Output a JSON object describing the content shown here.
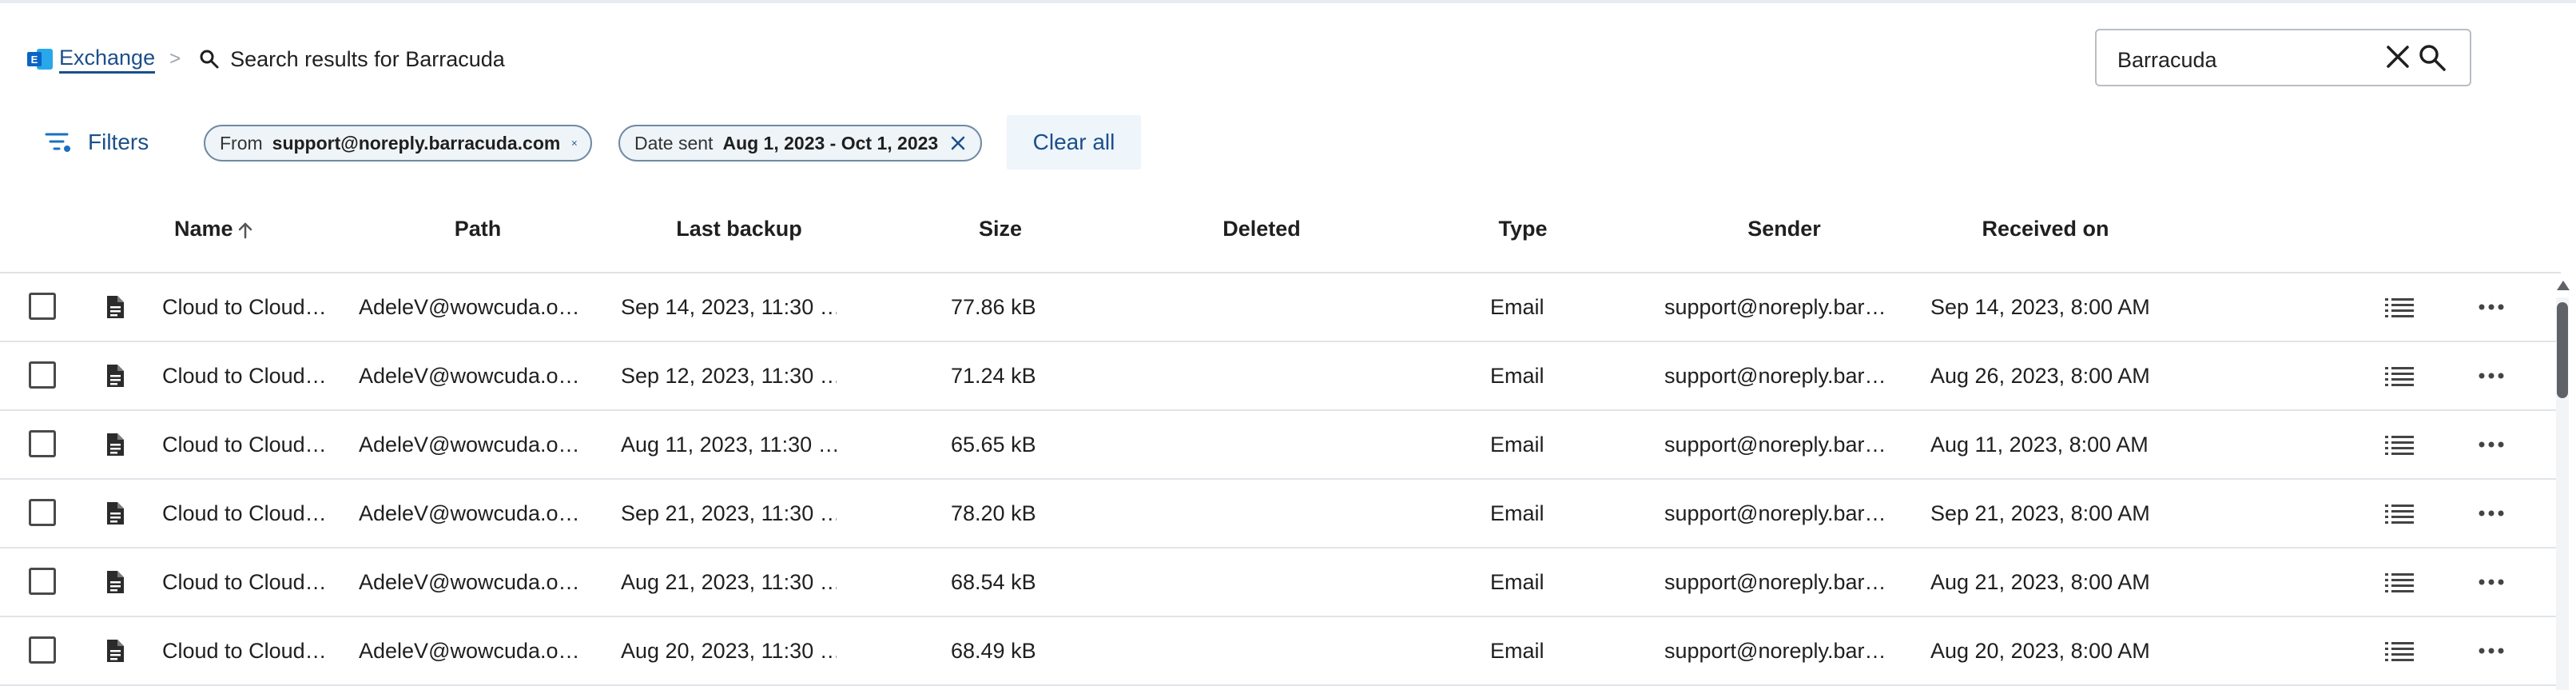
{
  "breadcrumb": {
    "app_label": "Exchange",
    "separator": ">",
    "current": "Search results for Barracuda"
  },
  "search": {
    "value": "Barracuda"
  },
  "filters": {
    "label": "Filters",
    "chips": [
      {
        "key": "From",
        "value": "support@noreply.barracuda.com"
      },
      {
        "key": "Date sent",
        "value": "Aug 1, 2023 - Oct 1, 2023"
      }
    ],
    "clear_all_label": "Clear all"
  },
  "table": {
    "columns": [
      "Name",
      "Path",
      "Last backup",
      "Size",
      "Deleted",
      "Type",
      "Sender",
      "Received on"
    ],
    "sort_column": "Name",
    "rows": [
      {
        "name": "Cloud to Cloud…",
        "path": "AdeleV@wowcuda.o…",
        "last_backup": "Sep 14, 2023, 11:30 …",
        "size": "77.86 kB",
        "deleted": "",
        "type": "Email",
        "sender": "support@noreply.bar…",
        "received_on": "Sep 14, 2023, 8:00 AM"
      },
      {
        "name": "Cloud to Cloud…",
        "path": "AdeleV@wowcuda.o…",
        "last_backup": "Sep 12, 2023, 11:30 …",
        "size": "71.24 kB",
        "deleted": "",
        "type": "Email",
        "sender": "support@noreply.bar…",
        "received_on": "Aug 26, 2023, 8:00 AM"
      },
      {
        "name": "Cloud to Cloud…",
        "path": "AdeleV@wowcuda.o…",
        "last_backup": "Aug 11, 2023, 11:30 …",
        "size": "65.65 kB",
        "deleted": "",
        "type": "Email",
        "sender": "support@noreply.bar…",
        "received_on": "Aug 11, 2023, 8:00 AM"
      },
      {
        "name": "Cloud to Cloud…",
        "path": "AdeleV@wowcuda.o…",
        "last_backup": "Sep 21, 2023, 11:30 …",
        "size": "78.20 kB",
        "deleted": "",
        "type": "Email",
        "sender": "support@noreply.bar…",
        "received_on": "Sep 21, 2023, 8:00 AM"
      },
      {
        "name": "Cloud to Cloud…",
        "path": "AdeleV@wowcuda.o…",
        "last_backup": "Aug 21, 2023, 11:30 …",
        "size": "68.54 kB",
        "deleted": "",
        "type": "Email",
        "sender": "support@noreply.bar…",
        "received_on": "Aug 21, 2023, 8:00 AM"
      },
      {
        "name": "Cloud to Cloud…",
        "path": "AdeleV@wowcuda.o…",
        "last_backup": "Aug 20, 2023, 11:30 …",
        "size": "68.49 kB",
        "deleted": "",
        "type": "Email",
        "sender": "support@noreply.bar…",
        "received_on": "Aug 20, 2023, 8:00 AM"
      }
    ]
  },
  "icons": {
    "app": "exchange-icon",
    "search": "search-icon",
    "clear": "close-icon",
    "filter": "filter-icon",
    "row_type": "document-icon",
    "row_details": "list-icon",
    "row_more": "more-horizontal-icon",
    "sort": "arrow-up-icon"
  },
  "colors": {
    "link": "#1b4f8a",
    "chip_border": "#6f8aa3",
    "chip_bg": "#eef4f8",
    "clear_all_bg": "#eef5fb",
    "exchange_blue": "#0a64c4",
    "exchange_light": "#28a8ea"
  }
}
